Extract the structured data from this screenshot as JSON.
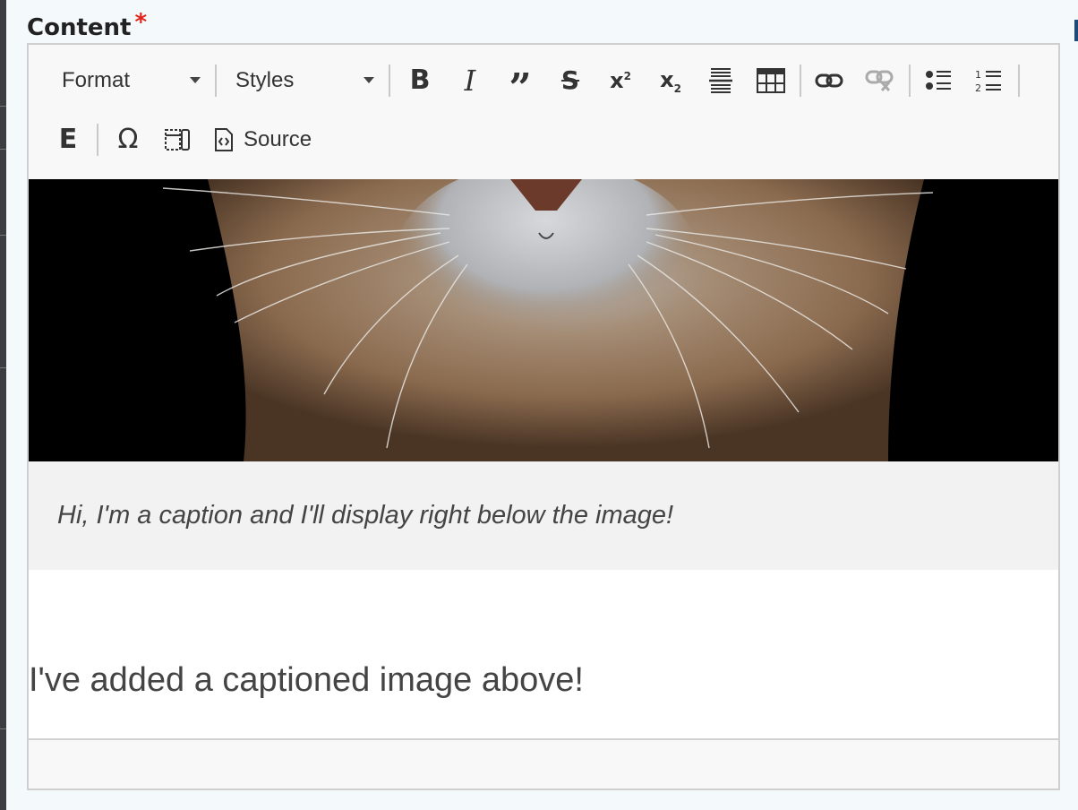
{
  "field": {
    "label": "Content",
    "required_mark": "*"
  },
  "toolbar": {
    "format_label": "Format",
    "styles_label": "Styles",
    "source_label": "Source",
    "buttons": [
      "bold",
      "italic",
      "blockquote",
      "strikethrough",
      "superscript",
      "subscript",
      "horizontal-line",
      "table",
      "link",
      "unlink",
      "bulleted-list",
      "numbered-list",
      "embed",
      "special-character",
      "show-blocks",
      "source"
    ]
  },
  "content": {
    "caption": "Hi, I'm a caption and I'll display right below the image!",
    "paragraph": "I've added a captioned image above!"
  },
  "colors": {
    "required": "#e1251b",
    "toolbar_bg": "#f8f8f8",
    "caption_bg": "#f2f2f2"
  }
}
